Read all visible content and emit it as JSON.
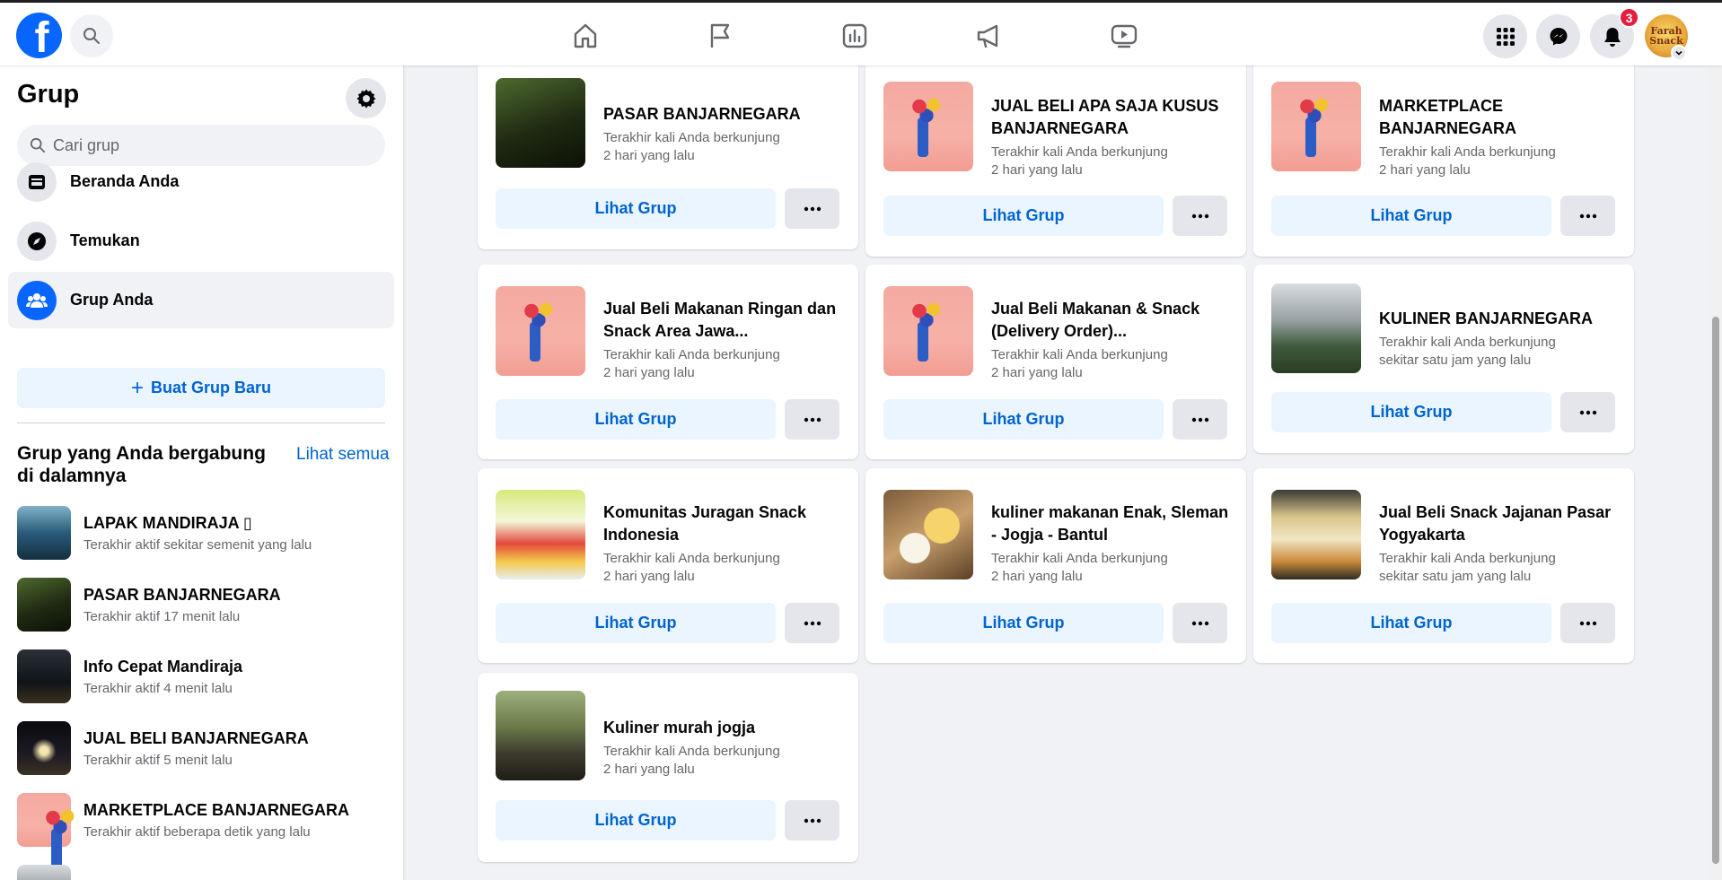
{
  "topbar": {
    "logo_letter": "f",
    "nav": [
      "home-icon",
      "flag-icon",
      "chart-icon",
      "megaphone-icon",
      "video-icon"
    ],
    "notifications_count": "3",
    "avatar_text": "Farah Snack"
  },
  "sidebar": {
    "title": "Grup",
    "search_placeholder": "Cari grup",
    "nav": [
      {
        "label": "Beranda Anda",
        "icon": "feed-icon"
      },
      {
        "label": "Temukan",
        "icon": "compass-icon"
      },
      {
        "label": "Grup Anda",
        "icon": "groups-icon"
      }
    ],
    "create_label": "Buat Grup Baru",
    "joined_heading": "Grup yang Anda bergabung di dalamnya",
    "see_all": "Lihat semua",
    "joined": [
      {
        "name": "LAPAK MANDIRAJA ▯",
        "sub": "Terakhir aktif sekitar semenit yang lalu"
      },
      {
        "name": "PASAR BANJARNEGARA",
        "sub": "Terakhir aktif 17 menit lalu"
      },
      {
        "name": "Info Cepat Mandiraja",
        "sub": "Terakhir aktif 4 menit lalu"
      },
      {
        "name": "JUAL BELI BANJARNEGARA",
        "sub": "Terakhir aktif 5 menit lalu"
      },
      {
        "name": "MARKETPLACE BANJARNEGARA",
        "sub": "Terakhir aktif beberapa detik yang lalu"
      }
    ]
  },
  "cards": [
    {
      "title": "PASAR BANJARNEGARA",
      "line1": "Terakhir kali Anda berkunjung",
      "line2": "2 hari yang lalu"
    },
    {
      "title": "JUAL BELI APA SAJA KUSUS BANJARNEGARA",
      "line1": "Terakhir kali Anda berkunjung",
      "line2": "2 hari yang lalu"
    },
    {
      "title": "MARKETPLACE BANJARNEGARA",
      "line1": "Terakhir kali Anda berkunjung",
      "line2": "2 hari yang lalu"
    },
    {
      "title": "Jual Beli Makanan Ringan dan Snack Area Jawa...",
      "line1": "Terakhir kali Anda berkunjung",
      "line2": "2 hari yang lalu"
    },
    {
      "title": "Jual Beli Makanan & Snack (Delivery Order)...",
      "line1": "Terakhir kali Anda berkunjung",
      "line2": "2 hari yang lalu"
    },
    {
      "title": "KULINER BANJARNEGARA",
      "line1": "Terakhir kali Anda berkunjung",
      "line2": "sekitar satu jam yang lalu"
    },
    {
      "title": "Komunitas Juragan Snack Indonesia",
      "line1": "Terakhir kali Anda berkunjung",
      "line2": "2 hari yang lalu"
    },
    {
      "title": "kuliner makanan Enak, Sleman - Jogja - Bantul",
      "line1": "Terakhir kali Anda berkunjung",
      "line2": "2 hari yang lalu"
    },
    {
      "title": "Jual Beli Snack Jajanan Pasar Yogyakarta",
      "line1": "Terakhir kali Anda berkunjung",
      "line2": "sekitar satu jam yang lalu"
    },
    {
      "title": "Kuliner murah jogja",
      "line1": "Terakhir kali Anda berkunjung",
      "line2": "2 hari yang lalu"
    }
  ],
  "card_button_label": "Lihat Grup"
}
